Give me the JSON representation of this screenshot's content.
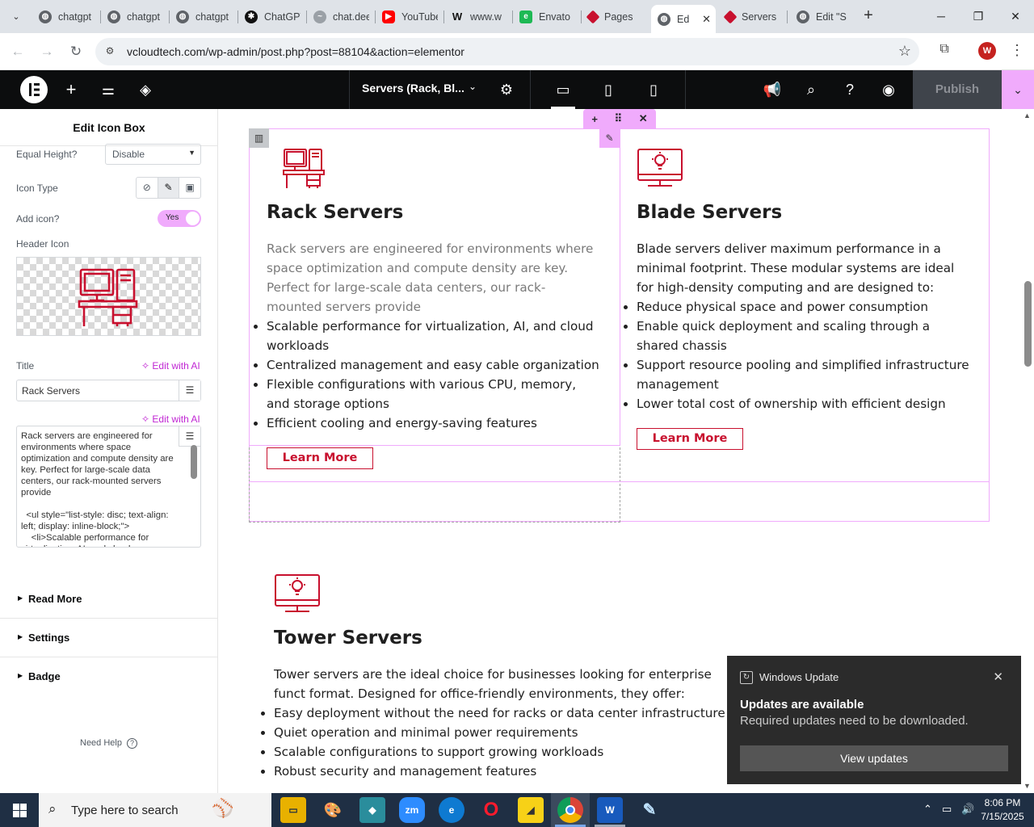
{
  "browser": {
    "tabs": [
      {
        "title": "chatgpt",
        "icon": "globe-icon"
      },
      {
        "title": "chatgpt",
        "icon": "globe-icon"
      },
      {
        "title": "chatgpt",
        "icon": "globe-icon"
      },
      {
        "title": "ChatGPT",
        "icon": "openai-icon"
      },
      {
        "title": "chat.deepseek",
        "icon": "deepseek-icon"
      },
      {
        "title": "YouTube",
        "icon": "youtube-icon"
      },
      {
        "title": "www.w",
        "icon": "wix-icon"
      },
      {
        "title": "Envato",
        "icon": "envato-icon"
      },
      {
        "title": "Pages",
        "icon": "diamond-icon"
      },
      {
        "title": "Ed",
        "icon": "globe-icon",
        "active": true
      },
      {
        "title": "Servers",
        "icon": "diamond-icon"
      },
      {
        "title": "Edit \"S",
        "icon": "globe-icon"
      }
    ],
    "url": "vcloudtech.com/wp-admin/post.php?post=88104&action=elementor",
    "profile_initial": "W"
  },
  "editor": {
    "document_title": "Servers (Rack, Bl...",
    "publish_label": "Publish",
    "accent_color": "#f0abfc"
  },
  "panel": {
    "title": "Edit Icon Box",
    "equal_height_label": "Equal Height?",
    "equal_height_value": "Disable",
    "icon_type_label": "Icon Type",
    "add_icon_label": "Add icon?",
    "add_icon_value": "Yes",
    "header_icon_label": "Header Icon",
    "title_label": "Title",
    "edit_with_ai": "Edit with AI",
    "title_value": "Rack Servers",
    "description_value": "Rack servers are engineered for environments where space optimization and compute density are key. Perfect for large-scale data centers, our rack-mounted servers provide\n\n  <ul style=\"list-style: disc; text-align: left; display: inline-block;\">\n    <li>Scalable performance for virtualization, AI, and cloud",
    "sections": [
      "Read More",
      "Settings",
      "Badge"
    ],
    "need_help": "Need Help"
  },
  "canvas": {
    "brand_color": "#c8102e",
    "cards": [
      {
        "title": "Rack Servers",
        "icon": "workstation-icon",
        "description": "Rack servers are engineered for environments where space optimization and compute density are key. Perfect for large-scale data centers, our rack-mounted servers provide",
        "bullets": [
          "Scalable performance for virtualization, AI, and cloud workloads",
          "Centralized management and easy cable organization",
          "Flexible configurations with various CPU, memory, and storage options",
          "Efficient cooling and energy-saving features"
        ],
        "button": "Learn More"
      },
      {
        "title": "Blade Servers",
        "icon": "monitor-bulb-icon",
        "description": "Blade servers deliver maximum performance in a minimal footprint. These modular systems are ideal for high-density computing and are designed to:",
        "bullets": [
          "Reduce physical space and power consumption",
          "Enable quick deployment and scaling through a shared chassis",
          "Support resource pooling and simplified infrastructure management",
          "Lower total cost of ownership with efficient design"
        ],
        "button": "Learn More"
      },
      {
        "title": "Tower Servers",
        "icon": "monitor-bulb-icon",
        "description": "Tower servers are the ideal choice for businesses looking for enterprise funct format. Designed for office-friendly environments, they offer:",
        "bullets": [
          "Easy deployment without the need for racks or data center infrastructure",
          "Quiet operation and minimal power requirements",
          "Scalable configurations to support growing workloads",
          "Robust security and management features"
        ]
      }
    ]
  },
  "toast": {
    "app": "Windows Update",
    "heading": "Updates are available",
    "body": "Required updates need to be downloaded.",
    "button": "View updates"
  },
  "taskbar": {
    "search_placeholder": "Type here to search",
    "time": "8:06 PM",
    "date": "7/15/2025"
  }
}
